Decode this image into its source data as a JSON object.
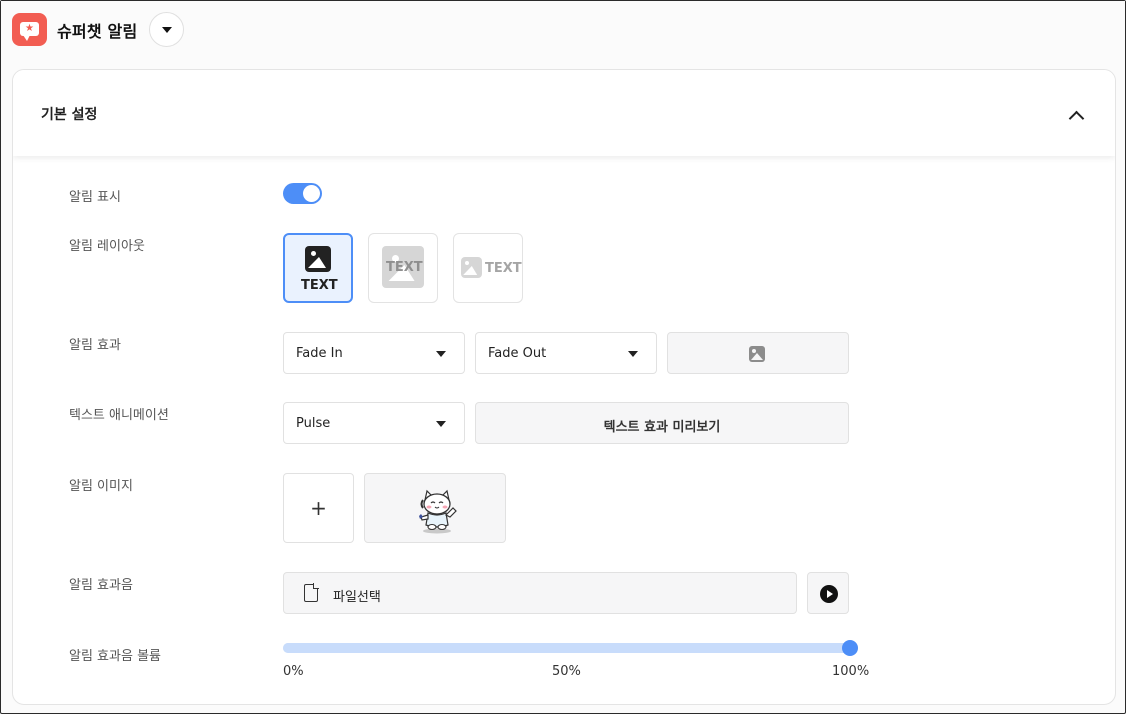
{
  "app": {
    "title": "슈퍼챗 알림",
    "icon": "chat-star-icon",
    "brand_color": "#f25d52"
  },
  "section": {
    "title": "기본 설정",
    "expanded": true
  },
  "labels": {
    "show": "알림 표시",
    "layout": "알림 레이아웃",
    "effect": "알림 효과",
    "text_animation": "텍스트 애니메이션",
    "image": "알림 이미지",
    "sound": "알림 효과음",
    "volume": "알림 효과음 볼륨"
  },
  "show_toggle": {
    "on": true,
    "accent": "#4d8ef7"
  },
  "layout_options": [
    {
      "text": "TEXT",
      "selected": true
    },
    {
      "text": "TEXT",
      "selected": false
    },
    {
      "text": "TEXT",
      "selected": false
    }
  ],
  "effect": {
    "in": "Fade In",
    "out": "Fade Out",
    "preview_icon": "image-icon"
  },
  "text_animation": {
    "value": "Pulse",
    "preview_label": "텍스트 효과 미리보기"
  },
  "image": {
    "add_label": "+",
    "current": "cat-mascot"
  },
  "sound": {
    "file_label": "파일선택",
    "play_icon": "play-icon"
  },
  "volume": {
    "value": 1.0,
    "ticks": [
      "0%",
      "50%",
      "100%"
    ]
  }
}
